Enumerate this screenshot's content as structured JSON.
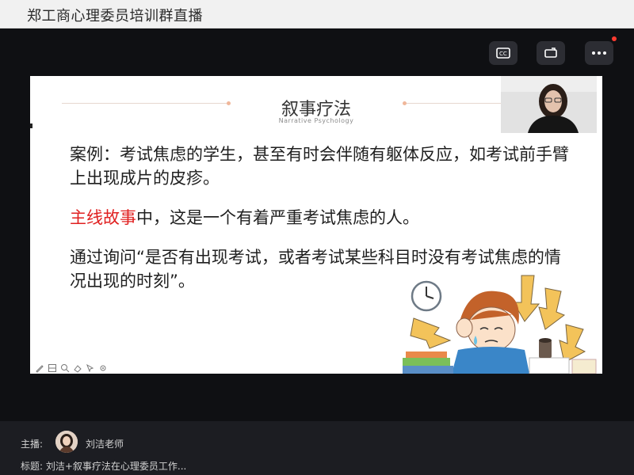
{
  "window": {
    "title": "郑工商心理委员培训群直播"
  },
  "controls": {
    "icons": [
      "subtitle-toggle-icon",
      "screen-rotate-icon",
      "more-icon"
    ],
    "notification_color": "#ff3b30"
  },
  "slide": {
    "title": "叙事疗法",
    "subtitle": "Narrative Psychology",
    "paragraph1": "案例：考试焦虑的学生，甚至有时会伴随有躯体反应，如考试前手臂上出现成片的皮疹。",
    "paragraph2_highlight": "主线故事",
    "paragraph2_rest": "中，这是一个有着严重考试焦虑的人。",
    "paragraph3": "通过询问“是否有出现考试，或者考试某些科目时没有考试焦虑的情况出现的时刻”。",
    "highlight_color": "#e02020",
    "tools": [
      "pen-icon",
      "layout-icon",
      "zoom-icon",
      "eraser-icon",
      "pointer-icon",
      "settings-icon"
    ]
  },
  "footer": {
    "host_label": "主播:",
    "host_name": "刘洁老师",
    "topic": "标题: 刘洁+叙事疗法在心理委员工作..."
  }
}
